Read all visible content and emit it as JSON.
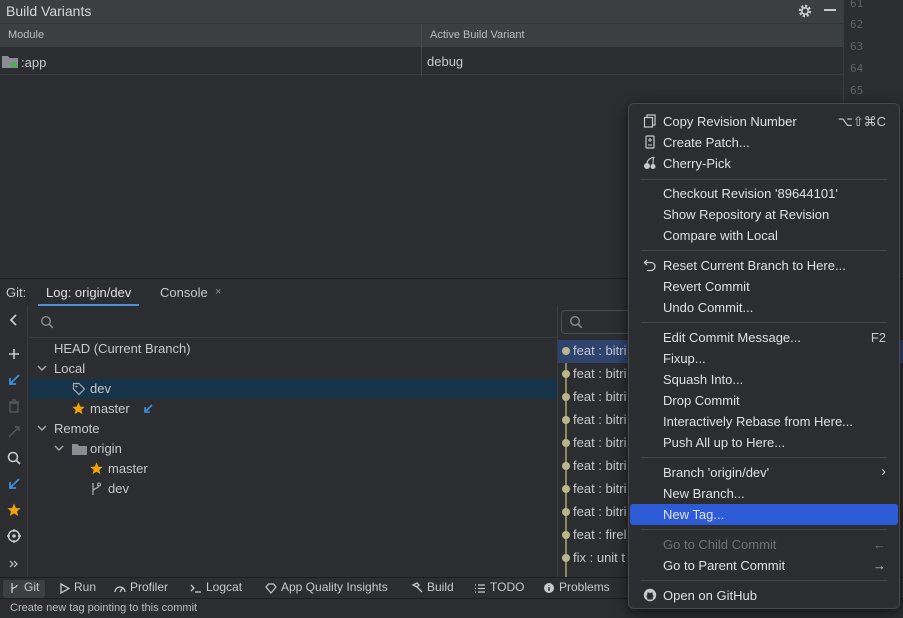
{
  "build_variants": {
    "title": "Build Variants",
    "col_module": "Module",
    "col_variant": "Active Build Variant",
    "rows": [
      {
        "module": ":app",
        "variant": "debug"
      }
    ]
  },
  "gutter": {
    "lines": [
      "61",
      "62",
      "63",
      "64",
      "65"
    ]
  },
  "git": {
    "label": "Git:",
    "tab_log": "Log: origin/dev",
    "tab_console": "Console",
    "tab_console_close": "×",
    "branches": {
      "head": "HEAD (Current Branch)",
      "local": "Local",
      "local_dev": "dev",
      "local_master": "master",
      "remote": "Remote",
      "origin": "origin",
      "origin_master": "master",
      "origin_dev": "dev"
    },
    "commits": [
      "feat : bitri",
      "feat : bitri",
      "feat : bitri",
      "feat : bitri",
      "feat : bitri",
      "feat : bitri",
      "feat : bitri",
      "feat : bitri",
      "feat : firel",
      "fix : unit t"
    ]
  },
  "context_menu": {
    "items": [
      {
        "label": "Copy Revision Number",
        "shortcut": "⌥⇧⌘C",
        "icon": "copy-icon"
      },
      {
        "label": "Create Patch...",
        "icon": "patch-icon"
      },
      {
        "label": "Cherry-Pick",
        "icon": "cherry-icon"
      },
      {
        "label": "Checkout Revision '89644101'"
      },
      {
        "label": "Show Repository at Revision"
      },
      {
        "label": "Compare with Local"
      },
      {
        "label": "Reset Current Branch to Here...",
        "icon": "undo-icon"
      },
      {
        "label": "Revert Commit"
      },
      {
        "label": "Undo Commit..."
      },
      {
        "label": "Edit Commit Message...",
        "shortcut": "F2"
      },
      {
        "label": "Fixup..."
      },
      {
        "label": "Squash Into..."
      },
      {
        "label": "Drop Commit"
      },
      {
        "label": "Interactively Rebase from Here..."
      },
      {
        "label": "Push All up to Here..."
      },
      {
        "label": "Branch 'origin/dev'",
        "shortcut": "›"
      },
      {
        "label": "New Branch..."
      },
      {
        "label": "New Tag..."
      },
      {
        "label": "Go to Child Commit",
        "shortcut": "←"
      },
      {
        "label": "Go to Parent Commit",
        "shortcut": "→"
      },
      {
        "label": "Open on GitHub",
        "icon": "github-icon"
      }
    ]
  },
  "bottom_tools": {
    "git": "Git",
    "run": "Run",
    "profiler": "Profiler",
    "logcat": "Logcat",
    "aqi": "App Quality Insights",
    "build": "Build",
    "todo": "TODO",
    "problems": "Problems"
  },
  "status": {
    "text": "Create new tag pointing to this commit"
  },
  "colors": {
    "selection": "#2e5bd6",
    "tree_selection": "#163349",
    "star": "#f0a30a",
    "accent_tab": "#4e8fdb"
  }
}
